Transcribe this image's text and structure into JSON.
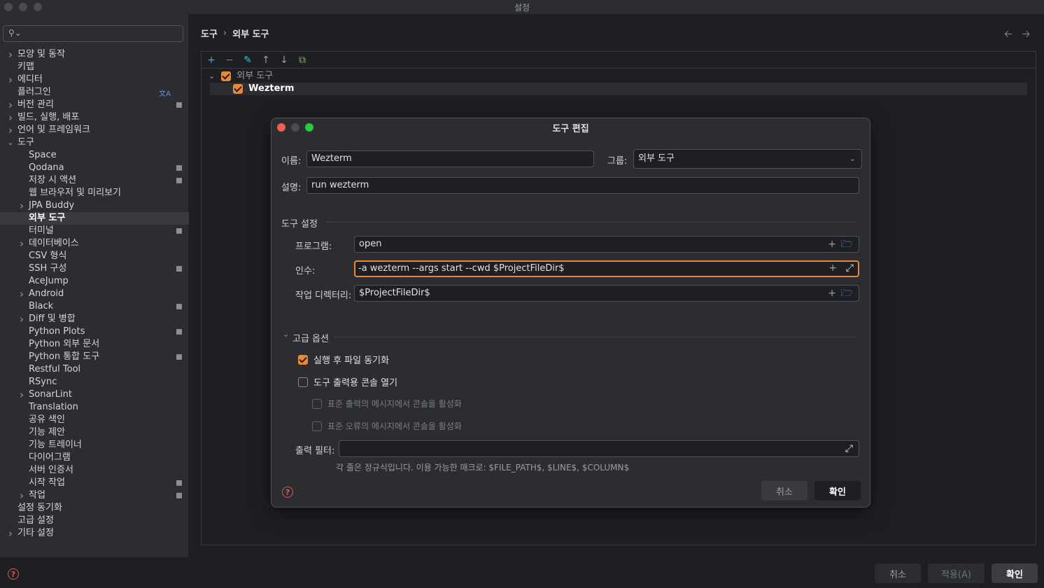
{
  "window": {
    "title": "설정"
  },
  "sidebar": {
    "search_placeholder": "",
    "items": [
      {
        "label": "모양 및 동작",
        "level": 0,
        "expandable": true
      },
      {
        "label": "키맵",
        "level": 0
      },
      {
        "label": "에디터",
        "level": 0,
        "expandable": true
      },
      {
        "label": "플러그인",
        "level": 0,
        "translate_icon": true
      },
      {
        "label": "버전 관리",
        "level": 0,
        "expandable": true,
        "badge": true
      },
      {
        "label": "빌드, 실행, 배포",
        "level": 0,
        "expandable": true
      },
      {
        "label": "언어 및 프레임워크",
        "level": 0,
        "expandable": true
      },
      {
        "label": "도구",
        "level": 0,
        "expanded": true
      },
      {
        "label": "Space",
        "level": 1
      },
      {
        "label": "Qodana",
        "level": 1,
        "badge": true
      },
      {
        "label": "저장 시 액션",
        "level": 1,
        "badge": true
      },
      {
        "label": "웹 브라우저 및 미리보기",
        "level": 1
      },
      {
        "label": "JPA Buddy",
        "level": 1,
        "expandable": true
      },
      {
        "label": "외부 도구",
        "level": 1,
        "selected": true
      },
      {
        "label": "터미널",
        "level": 1,
        "badge": true
      },
      {
        "label": "데이터베이스",
        "level": 1,
        "expandable": true
      },
      {
        "label": "CSV 형식",
        "level": 1
      },
      {
        "label": "SSH 구성",
        "level": 1,
        "badge": true
      },
      {
        "label": "AceJump",
        "level": 1
      },
      {
        "label": "Android",
        "level": 1,
        "expandable": true
      },
      {
        "label": "Black",
        "level": 1,
        "badge": true
      },
      {
        "label": "Diff 및 병합",
        "level": 1,
        "expandable": true
      },
      {
        "label": "Python Plots",
        "level": 1,
        "badge": true
      },
      {
        "label": "Python 외부 문서",
        "level": 1
      },
      {
        "label": "Python 통합 도구",
        "level": 1,
        "badge": true
      },
      {
        "label": "Restful Tool",
        "level": 1
      },
      {
        "label": "RSync",
        "level": 1
      },
      {
        "label": "SonarLint",
        "level": 1,
        "expandable": true
      },
      {
        "label": "Translation",
        "level": 1
      },
      {
        "label": "공유 색인",
        "level": 1
      },
      {
        "label": "기능 제안",
        "level": 1
      },
      {
        "label": "기능 트레이너",
        "level": 1
      },
      {
        "label": "다이어그램",
        "level": 1
      },
      {
        "label": "서버 인증서",
        "level": 1
      },
      {
        "label": "시작 작업",
        "level": 1,
        "badge": true
      },
      {
        "label": "작업",
        "level": 1,
        "expandable": true,
        "badge": true
      },
      {
        "label": "설정 동기화",
        "level": 0
      },
      {
        "label": "고급 설정",
        "level": 0
      },
      {
        "label": "기타 설정",
        "level": 0,
        "expandable": true
      }
    ]
  },
  "breadcrumb": {
    "parent": "도구",
    "separator": "›",
    "current": "외부 도구"
  },
  "tools_tree": {
    "group_label": "외부 도구",
    "tool_label": "Wezterm"
  },
  "dialog": {
    "title": "도구 편집",
    "name_label": "이름:",
    "name_value": "Wezterm",
    "group_label": "그룹:",
    "group_value": "외부 도구",
    "description_label": "설명:",
    "description_value": "run wezterm",
    "tool_settings_title": "도구 설정",
    "program_label": "프로그램:",
    "program_value": "open",
    "arguments_label": "인수:",
    "arguments_value": "-a wezterm --args start --cwd $ProjectFileDir$",
    "workdir_label": "작업 디렉터리:",
    "workdir_value": "$ProjectFileDir$",
    "advanced_title": "고급 옵션",
    "sync_files_label": "실행 후 파일 동기화",
    "sync_files_checked": true,
    "open_console_label": "도구 출력용 콘솔 열기",
    "open_console_checked": false,
    "stdout_label": "표준 출력의 메시지에서 콘솔을 활성화",
    "stderr_label": "표준 오류의 메시지에서 콘솔을 활성화",
    "output_filter_label": "출력 필터:",
    "output_filter_value": "",
    "hint": "각 줄은 정규식입니다. 이용 가능한 매크로: $FILE_PATH$, $LINE$, $COLUMN$",
    "cancel_label": "취소",
    "ok_label": "확인"
  },
  "footer": {
    "cancel_label": "취소",
    "apply_label": "적용(A)",
    "ok_label": "확인"
  },
  "icons": {
    "search": "search-icon",
    "chevron": "chevron-right-icon",
    "help": "help-icon",
    "add": "plus-icon",
    "remove": "minus-icon",
    "edit": "pencil-icon",
    "up": "arrow-up-icon",
    "down": "arrow-down-icon",
    "copy": "copy-icon",
    "folder": "folder-icon",
    "expand": "expand-icon"
  },
  "colors": {
    "accent_checkbox": "#e9883a",
    "focus_border": "#e9883a",
    "add_icon": "#3fa5ec",
    "remove_icon": "#e15a5a",
    "help_icon": "#e05555",
    "close_traffic": "#ed5f57",
    "zoom_traffic": "#2ac840"
  }
}
